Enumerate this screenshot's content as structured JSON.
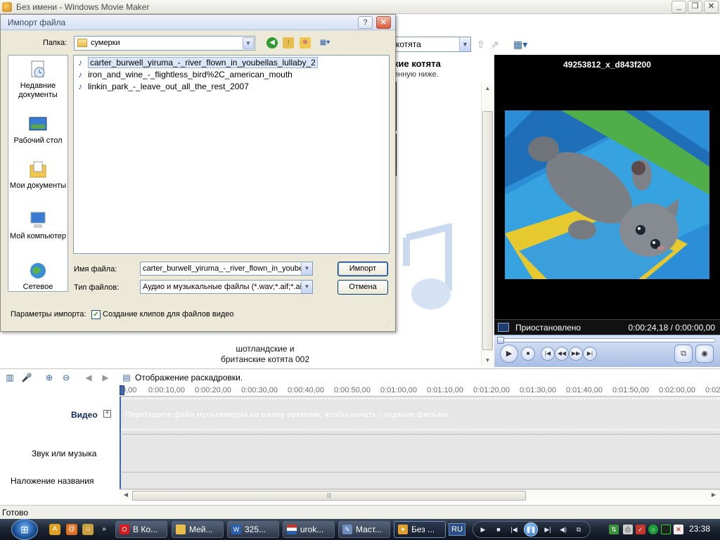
{
  "window": {
    "title": "Без имени - Windows Movie Maker",
    "controls": [
      "_",
      "❐",
      "✕"
    ]
  },
  "collection": {
    "combo_value": "котята",
    "title_fragment": "кие котята",
    "subtitle_fragment": "енную ниже.",
    "clip_caption_line1": "шотландские и",
    "clip_caption_line2": "британские котята 002"
  },
  "monitor": {
    "clip_name": "49253812_x_d843f200",
    "status": "Приостановлено",
    "time": "0:00:24,18 / 0:00:00,00"
  },
  "storyboard": {
    "toggle_label": "Отображение раскадровки."
  },
  "timeline": {
    "ticks": [
      "0,00",
      "0:00:10,00",
      "0:00:20,00",
      "0:00:30,00",
      "0:00:40,00",
      "0:00:50,00",
      "0:01:00,00",
      "0:01:10,00",
      "0:01:20,00",
      "0:01:30,00",
      "0:01:40,00",
      "0:01:50,00",
      "0:02:00,00",
      "0:02"
    ],
    "video_label": "Видео",
    "expand_symbol": "+",
    "audio_label": "Звук или музыка",
    "title_label": "Наложение названия",
    "video_hint": "Перетащите файл мультимедиа на шкалу времени, чтобы начать создание фильма."
  },
  "status_bar": {
    "text": "Готово"
  },
  "dialog": {
    "title": "Импорт файла",
    "help": "?",
    "close": "✕",
    "folder_label": "Папка:",
    "folder_value": "сумерки",
    "places": [
      {
        "label": "Недавние документы",
        "icon": "recent-documents-icon"
      },
      {
        "label": "Рабочий стол",
        "icon": "desktop-icon"
      },
      {
        "label": "Мои документы",
        "icon": "my-documents-icon"
      },
      {
        "label": "Мой компьютер",
        "icon": "my-computer-icon"
      },
      {
        "label": "Сетевое",
        "icon": "network-icon"
      }
    ],
    "files": [
      "carter_burwell_yiruma_-_river_flown_in_youbellas_lullaby_2",
      "iron_and_wine_-_flightless_bird%2C_american_mouth",
      "linkin_park_-_leave_out_all_the_rest_2007"
    ],
    "filename_label": "Имя файла:",
    "filename_value": "carter_burwell_yiruma_-_river_flown_in_youbell",
    "filetype_label": "Тип файлов:",
    "filetype_value": "Аудио и музыкальные файлы (*.wav;*.aif;*.ai",
    "import_button": "Импорт",
    "cancel_button": "Отмена",
    "options_label": "Параметры импорта:",
    "create_clips_label": "Создание клипов для файлов видео",
    "create_clips_checked": true
  },
  "taskbar": {
    "buttons": [
      {
        "label": "В Ко...",
        "icon": "opera-icon",
        "color": "#d71920"
      },
      {
        "label": "Мей...",
        "icon": "folder-icon",
        "color": "#e8bd4c"
      },
      {
        "label": "325...",
        "icon": "word-icon",
        "color": "#2b5fb0"
      },
      {
        "label": "urok...",
        "icon": "flag-icon",
        "color": "#c2362d"
      },
      {
        "label": "Маст...",
        "icon": "wizard-icon",
        "color": "#6d8bbd"
      },
      {
        "label": "Без ...",
        "icon": "movie-maker-icon",
        "color": "#e0a030"
      }
    ],
    "language": "RU",
    "clock": "23:38"
  },
  "colors": {
    "accent": "#3b68b8",
    "dialog_bg": "#ece9d8",
    "monitor_bg": "#000000"
  }
}
